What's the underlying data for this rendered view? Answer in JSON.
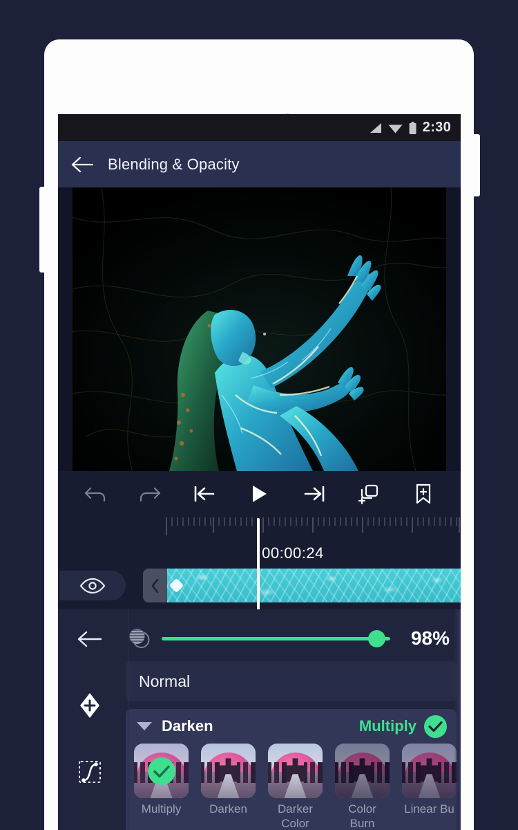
{
  "status_bar": {
    "time": "2:30",
    "icons": [
      "signal-icon",
      "wifi-icon",
      "battery-icon"
    ]
  },
  "app_bar": {
    "back_icon": "arrow-left-icon",
    "title": "Blending & Opacity"
  },
  "preview": {
    "alt": "Dancer with teal water light projection on black background"
  },
  "transport": {
    "buttons": [
      {
        "name": "undo-button",
        "icon": "undo-icon"
      },
      {
        "name": "redo-button",
        "icon": "redo-icon"
      },
      {
        "name": "skip-to-start-button",
        "icon": "skip-start-icon"
      },
      {
        "name": "play-button",
        "icon": "play-icon"
      },
      {
        "name": "skip-to-end-button",
        "icon": "skip-end-icon"
      },
      {
        "name": "duplicate-layer-button",
        "icon": "duplicate-icon"
      },
      {
        "name": "add-marker-button",
        "icon": "bookmark-plus-icon"
      }
    ]
  },
  "timeline": {
    "timecode": "00:00:24",
    "visibility_icon": "eye-icon",
    "clip_handle_icon": "chevron-left-icon",
    "keyframe_icon": "keyframe-diamond-icon"
  },
  "left_rail": {
    "items": [
      {
        "name": "rail-back-button",
        "icon": "arrow-left-icon"
      },
      {
        "name": "rail-add-keyframe-button",
        "icon": "keyframe-plus-icon"
      },
      {
        "name": "rail-easing-button",
        "icon": "easing-curve-icon"
      }
    ]
  },
  "opacity": {
    "icon": "opacity-icon",
    "value_label": "98%",
    "percent": 98,
    "accent": "#3ee08f"
  },
  "blend_mode_field": {
    "value": "Normal"
  },
  "blend_panel": {
    "caret_icon": "caret-down-icon",
    "group": "Darken",
    "selected": "Multiply",
    "check_icon": "check-circle-icon",
    "modes": [
      {
        "label": "Multiply",
        "selected": true
      },
      {
        "label": "Darken",
        "selected": false
      },
      {
        "label": "Darker\nColor",
        "selected": false
      },
      {
        "label": "Color Burn",
        "selected": false
      },
      {
        "label": "Linear Bu",
        "selected": false
      }
    ]
  },
  "colors": {
    "page_background": "#1c2039",
    "screen_background": "#20243d",
    "app_bar": "#2a3050",
    "status_bar": "#16161c",
    "panel": "#323757",
    "accent_green": "#3ee08f",
    "clip_cyan": "#49cfd8"
  }
}
